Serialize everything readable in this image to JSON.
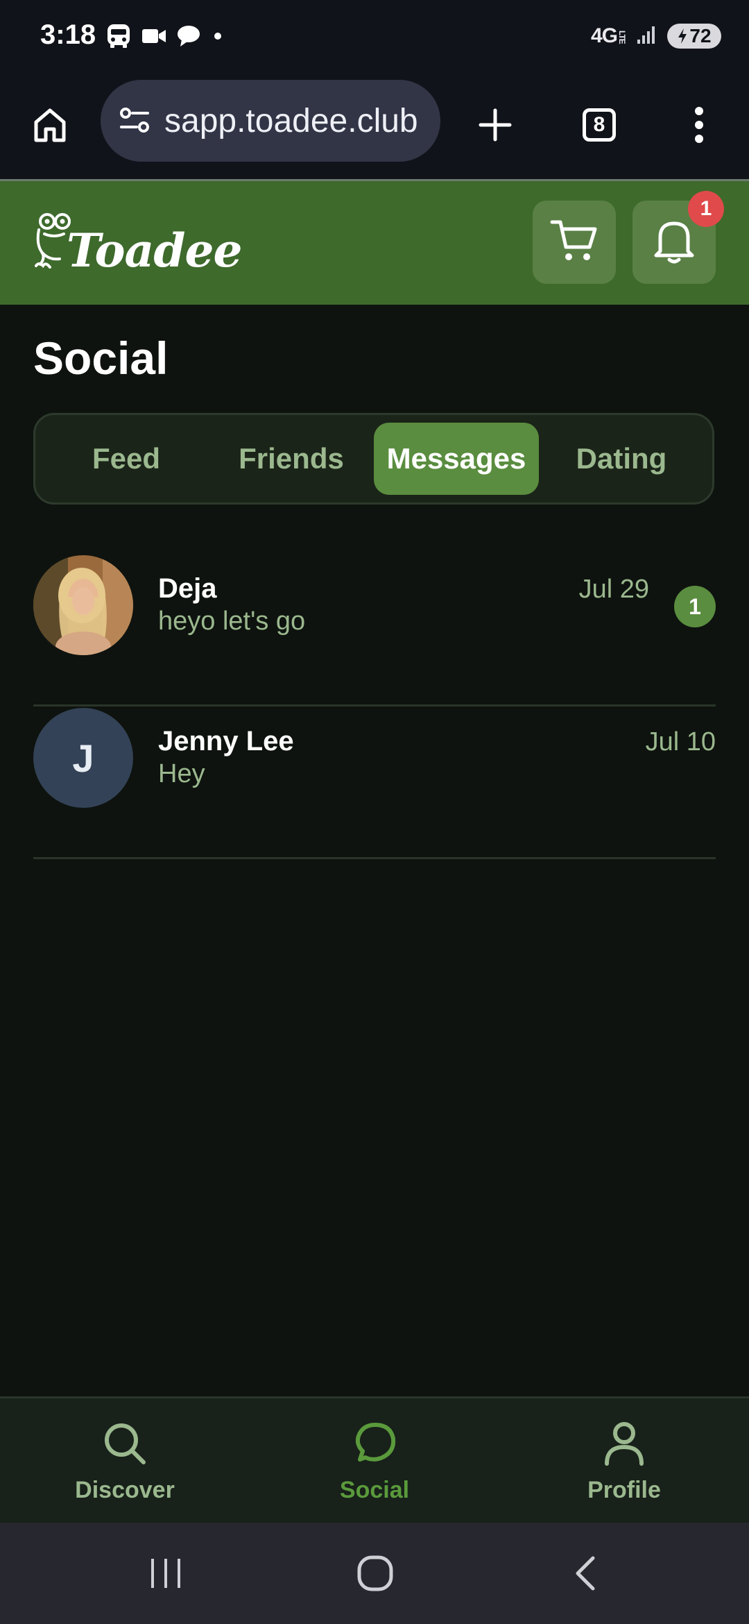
{
  "status_bar": {
    "time": "3:18",
    "network": "4G",
    "network_sub": "LTE",
    "battery": "72",
    "icons": [
      "bus-icon",
      "video-camera-icon",
      "chat-bubble-icon",
      "dot-icon",
      "signal-icon",
      "battery-charging-icon"
    ]
  },
  "browser": {
    "url": "sapp.toadee.club",
    "tab_count": "8",
    "icons": [
      "home-icon",
      "site-settings-icon",
      "new-tab-plus-icon",
      "overflow-menu-icon"
    ]
  },
  "header": {
    "logo_text": "Toadee",
    "notification_count": "1",
    "icons": [
      "frog-logo-icon",
      "cart-icon",
      "bell-icon"
    ]
  },
  "page": {
    "title": "Social",
    "tabs": [
      {
        "label": "Feed"
      },
      {
        "label": "Friends"
      },
      {
        "label": "Messages"
      },
      {
        "label": "Dating"
      }
    ],
    "active_tab": "Messages"
  },
  "messages": [
    {
      "name": "Deja",
      "preview": "heyo let's go",
      "date": "Jul 29",
      "unread": "1",
      "avatar": "photo"
    },
    {
      "name": "Jenny Lee",
      "preview": "Hey",
      "date": "Jul 10",
      "avatar_letter": "J"
    }
  ],
  "bottom_nav": {
    "items": [
      {
        "label": "Discover",
        "icon": "search-icon"
      },
      {
        "label": "Social",
        "icon": "chat-bubble-icon"
      },
      {
        "label": "Profile",
        "icon": "person-icon"
      }
    ],
    "active": "Social"
  },
  "system_nav": {
    "icons": [
      "recents-icon",
      "home-circle-icon",
      "back-chevron-icon"
    ]
  },
  "colors": {
    "header_green": "#3e6a2c",
    "accent_green": "#5a8d3f",
    "muted_green_text": "#9bb88e",
    "background": "#0e130f",
    "badge_red": "#e04a4a"
  }
}
